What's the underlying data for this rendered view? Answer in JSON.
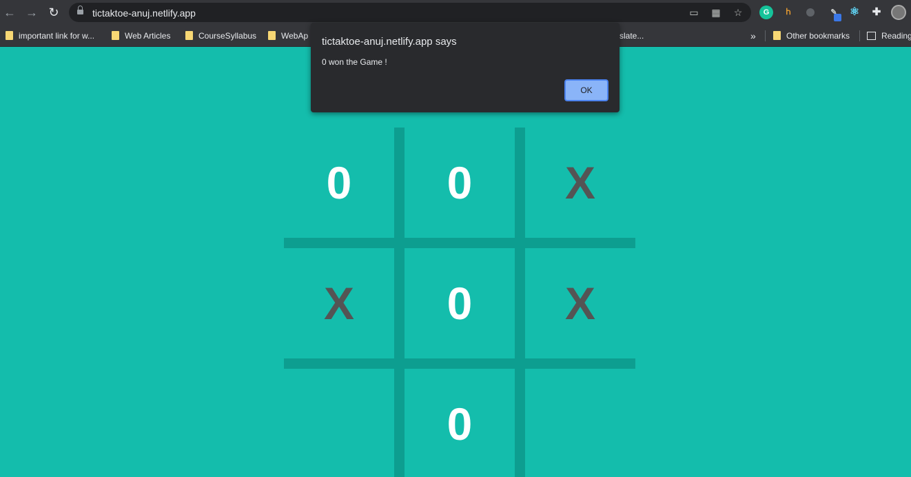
{
  "browser": {
    "url": "tictaktoe-anuj.netlify.app",
    "back_icon": "arrow-left",
    "forward_icon": "arrow-right",
    "reload_icon": "reload",
    "omnibox_icons": [
      "cast-icon",
      "qr-icon",
      "star-icon"
    ],
    "extensions": [
      "grammarly-icon",
      "extension-icon",
      "record-icon",
      "eyedropper-icon",
      "react-devtools-icon",
      "puzzle-icon",
      "profile-avatar"
    ]
  },
  "bookmarks": {
    "items": [
      {
        "label": "important link for w..."
      },
      {
        "label": "Web Articles"
      },
      {
        "label": "CourseSyllabus"
      },
      {
        "label": "WebAp"
      },
      {
        "label": "slate..."
      }
    ],
    "overflow": "»",
    "other": "Other bookmarks",
    "reading": "Reading"
  },
  "board": {
    "cells": [
      "0",
      "0",
      "X",
      "X",
      "0",
      "X",
      "",
      "0",
      ""
    ]
  },
  "dialog": {
    "title": "tictaktoe-anuj.netlify.app says",
    "message": "0 won the Game !",
    "ok_label": "OK"
  },
  "colors": {
    "background": "#14bdac",
    "grid": "#0d9e90",
    "o_mark": "#ffffff",
    "x_mark": "#545454",
    "accent": "#8ab4f8"
  }
}
